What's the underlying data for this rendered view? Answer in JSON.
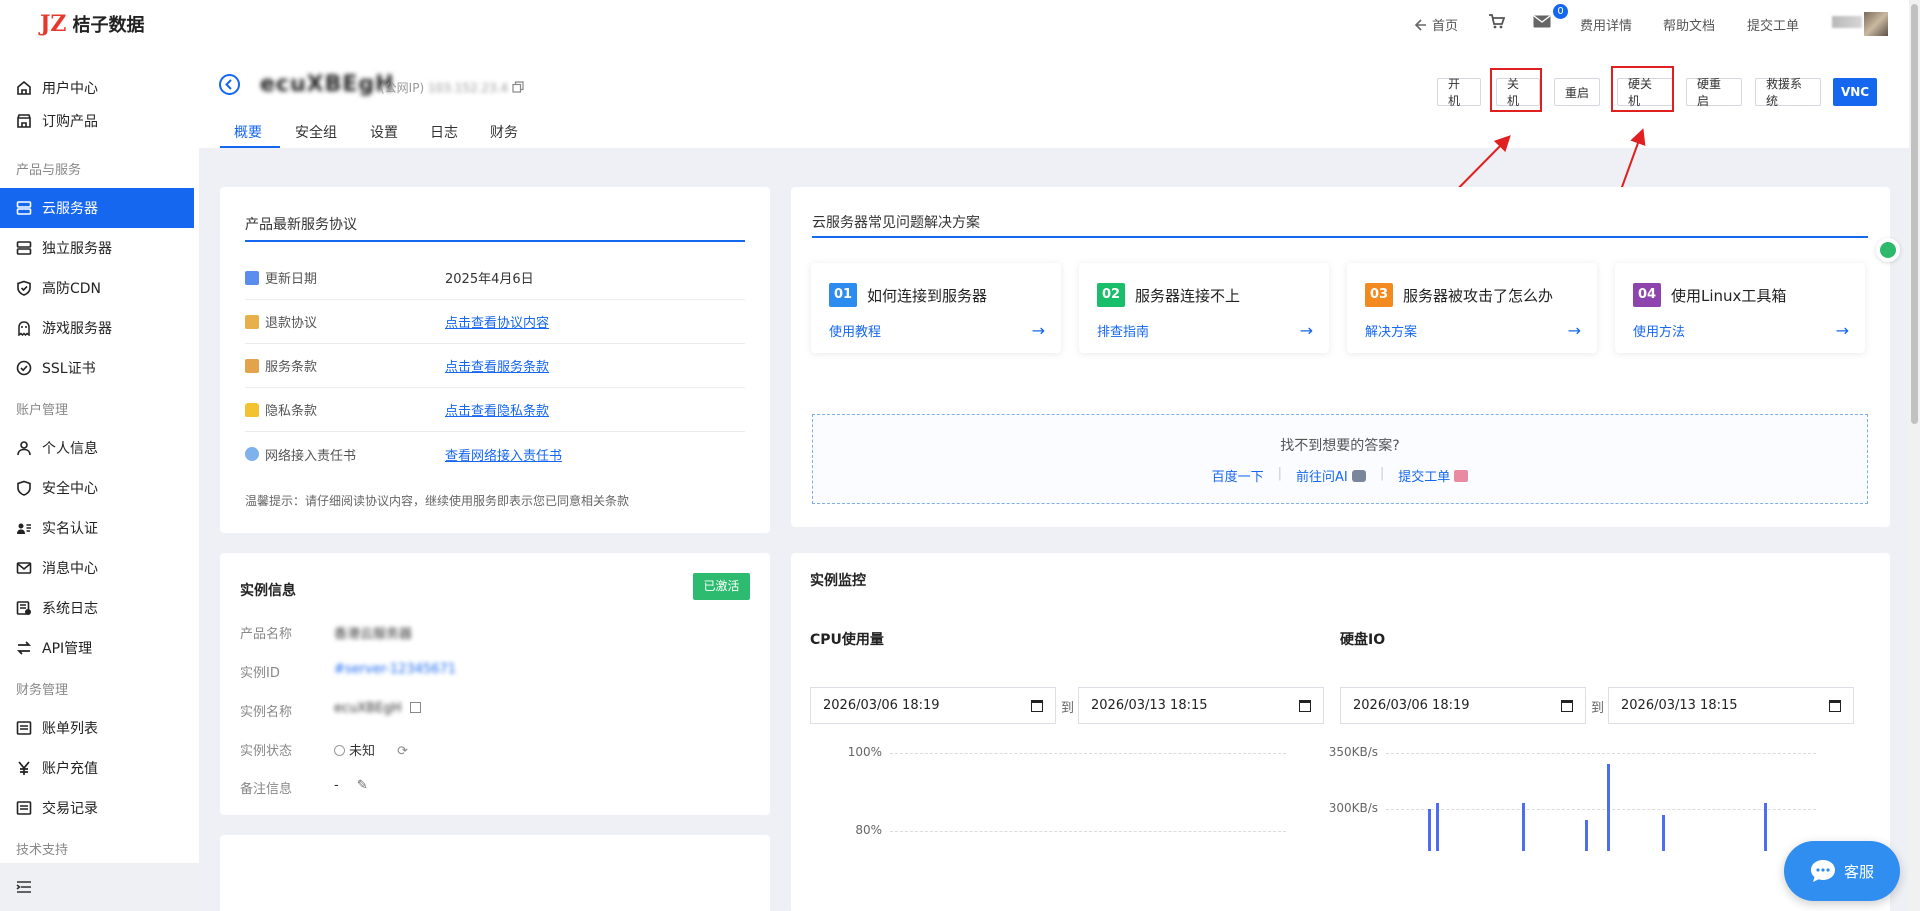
{
  "app": {
    "brand_mark": "JZ",
    "brand_name": "桔子数据"
  },
  "topnav": {
    "home": "首页",
    "message_count": "0",
    "billing": "费用详情",
    "help": "帮助文档",
    "ticket": "提交工单"
  },
  "sidebar": {
    "items": [
      {
        "label": "用户中心",
        "icon": "home-icon"
      },
      {
        "label": "订购产品",
        "icon": "store-icon"
      },
      {
        "label": "云服务器",
        "icon": "server-icon",
        "active": true
      },
      {
        "label": "独立服务器",
        "icon": "server-icon"
      },
      {
        "label": "高防CDN",
        "icon": "shield-check-icon"
      },
      {
        "label": "游戏服务器",
        "icon": "ghost-icon"
      },
      {
        "label": "SSL证书",
        "icon": "check-circle-icon"
      },
      {
        "label": "个人信息",
        "icon": "user-icon"
      },
      {
        "label": "安全中心",
        "icon": "shield-icon"
      },
      {
        "label": "实名认证",
        "icon": "id-card-icon"
      },
      {
        "label": "消息中心",
        "icon": "mail-icon"
      },
      {
        "label": "系统日志",
        "icon": "log-icon"
      },
      {
        "label": "API管理",
        "icon": "swap-icon"
      },
      {
        "label": "账单列表",
        "icon": "list-icon"
      },
      {
        "label": "账户充值",
        "icon": "yen-icon"
      },
      {
        "label": "交易记录",
        "icon": "list-icon"
      }
    ],
    "categories": [
      "产品与服务",
      "账户管理",
      "财务管理",
      "技术支持"
    ]
  },
  "instance": {
    "name": "ecuXBEgH",
    "ip_label": "(公网IP)",
    "ip_value": "103.152.23.4"
  },
  "tabs": [
    "概要",
    "安全组",
    "设置",
    "日志",
    "财务"
  ],
  "actions": {
    "power_on": "开机",
    "shutdown": "关机",
    "restart": "重启",
    "hard_shutdown": "硬关机",
    "hard_restart": "硬重启",
    "rescue": "救援系统",
    "vnc": "VNC"
  },
  "agreement": {
    "title": "产品最新服务协议",
    "rows": [
      {
        "label": "更新日期",
        "value": "2025年4月6日",
        "link": false
      },
      {
        "label": "退款协议",
        "value": "点击查看协议内容",
        "link": true
      },
      {
        "label": "服务条款",
        "value": "点击查看服务条款",
        "link": true
      },
      {
        "label": "隐私条款",
        "value": "点击查看隐私条款",
        "link": true
      },
      {
        "label": "网络接入责任书",
        "value": "查看网络接入责任书",
        "link": true
      }
    ],
    "tip": "温馨提示：请仔细阅读协议内容，继续使用服务即表示您已同意相关条款"
  },
  "faq": {
    "title": "云服务器常见问题解决方案",
    "cards": [
      {
        "num": "01",
        "title": "如何连接到服务器",
        "link": "使用教程",
        "color": "#2d8cf0"
      },
      {
        "num": "02",
        "title": "服务器连接不上",
        "link": "排查指南",
        "color": "#19be6b"
      },
      {
        "num": "03",
        "title": "服务器被攻击了怎么办",
        "link": "解决方案",
        "color": "#f28a20"
      },
      {
        "num": "04",
        "title": "使用Linux工具箱",
        "link": "使用方法",
        "color": "#8e44ad"
      }
    ],
    "help_question": "找不到想要的答案?",
    "help_links": [
      "百度一下",
      "前往问AI",
      "提交工单"
    ]
  },
  "instance_info": {
    "title": "实例信息",
    "status_badge": "已激活",
    "rows": [
      {
        "label": "产品名称",
        "value": "香港云服务器"
      },
      {
        "label": "实例ID",
        "value": "#server-12345671"
      },
      {
        "label": "实例名称",
        "value": "ecuXBEgH"
      },
      {
        "label": "实例状态",
        "value": "未知"
      },
      {
        "label": "备注信息",
        "value": "-"
      }
    ]
  },
  "monitor": {
    "title": "实例监控",
    "cpu": {
      "title": "CPU使用量",
      "date_from": "2026/03/06 18:19",
      "to": "到",
      "date_to": "2026/03/13 18:15"
    },
    "disk": {
      "title": "硬盘IO",
      "date_from": "2026/03/06 18:19",
      "to": "到",
      "date_to": "2026/03/13 18:15"
    }
  },
  "chart_data": [
    {
      "type": "line",
      "title": "CPU使用量",
      "yticks": [
        "100%",
        "80%"
      ],
      "series": []
    },
    {
      "type": "bar",
      "title": "硬盘IO",
      "yticks": [
        "350KB/s",
        "300KB/s"
      ],
      "values": [
        300,
        305,
        305,
        290,
        340,
        295,
        305
      ]
    }
  ],
  "support": {
    "label": "客服"
  }
}
